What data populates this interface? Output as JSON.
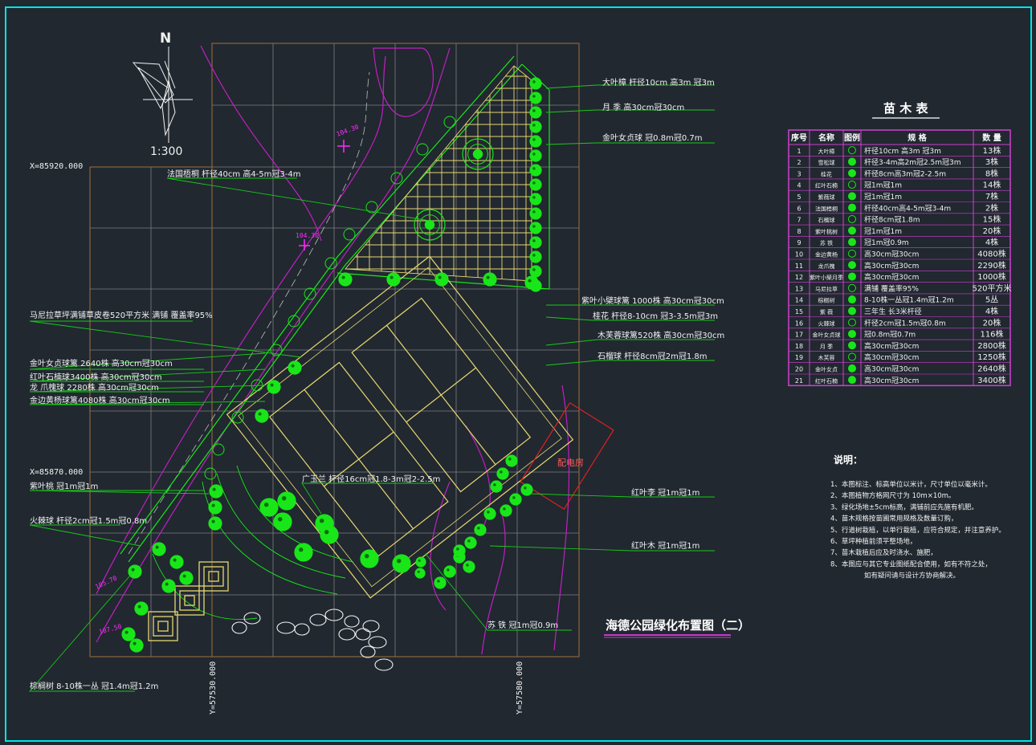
{
  "colors": {
    "background": "#212830",
    "frame": "#00e5e5",
    "grid": "#7f7f7f",
    "plan_outline": "#a0703a",
    "paving": "#e8d870",
    "tree": "#19e619",
    "road": "#c020c0",
    "leader": "#19c919",
    "text": "#f2f2f2",
    "elevation": "#ff2bff",
    "substation": "#e02020",
    "title": "#ffffff",
    "table_border": "#d040d0"
  },
  "north": {
    "letter": "N",
    "scale": "1:300"
  },
  "coordinates": {
    "x_top": "X=85920.000",
    "x_mid": "X=85870.000",
    "y_left": "Y=57530.000",
    "y_right": "Y=57580.000"
  },
  "elevations": [
    "104.30",
    "104.30",
    "105.70",
    "107.50"
  ],
  "substation_label": "配电房",
  "plan_title": "海德公园绿化布置图（二）",
  "left_callouts": [
    "法国梧桐  杆径40cm  高4-5m冠3-4m",
    "马尼拉草坪满铺草皮卷520平方米      满铺      覆盖率95%",
    "金叶女贞球篱  2640株  高30cm冠30cm",
    "红叶石楠球3400株  高30cm冠30cm",
    "龙      爪槐球  2280株  高30cm冠30cm",
    "金边黄杨球篱4080株  高30cm冠30cm",
    "紫叶桃  冠1m冠1m",
    "火棘球  杆径2cm冠1.5m冠0.8m",
    "棕榈树  8-10株一丛  冠1.4m冠1.2m"
  ],
  "right_callouts": [
    "大叶樟  杆径10cm  高3m  冠3m",
    "月      季  高30cm冠30cm",
    "金叶女贞球  冠0.8m冠0.7m",
    "紫叶小檗球篱  1000株  高30cm冠30cm",
    "桂花  杆径8-10cm  冠3-3.5m冠3m",
    "木芙蓉球篱520株  高30cm冠30cm",
    "石榴球  杆径8cm冠2m冠1.8m",
    "红叶李  冠1m冠1m",
    "红叶木  冠1m冠1m",
    "苏      铁  冠1m冠0.9m"
  ],
  "mid_callout": "广玉兰  杆径16cm冠1.8-3m冠2-2.5m",
  "nursery_table": {
    "title": "苗 木 表",
    "headers": [
      "序号",
      "名称",
      "图例",
      "规      格",
      "数 量"
    ],
    "rows": [
      [
        "1",
        "大叶樟",
        "杆径10cm  高3m  冠3m",
        "13株"
      ],
      [
        "2",
        "雪松球",
        "杆径3-4m高2m冠2.5m冠3m",
        "3株"
      ],
      [
        "3",
        "桂花",
        "杆径8cm高3m冠2-2.5m",
        "8株"
      ],
      [
        "4",
        "红叶石楠",
        "冠1m冠1m",
        "14株"
      ],
      [
        "5",
        "紫薇球",
        "冠1m冠1m",
        "7株"
      ],
      [
        "6",
        "法国梧桐",
        "杆径40cm高4-5m冠3-4m",
        "2株"
      ],
      [
        "7",
        "石榴球",
        "杆径8cm冠1.8m",
        "15株"
      ],
      [
        "8",
        "紫叶桃树",
        "冠1m冠1m",
        "20株"
      ],
      [
        "9",
        "苏      铁",
        "冠1m冠0.9m",
        "4株"
      ],
      [
        "10",
        "金边黄杨",
        "高30cm冠30cm",
        "4080株"
      ],
      [
        "11",
        "龙爪槐",
        "高30cm冠30cm",
        "2290株"
      ],
      [
        "12",
        "紫叶小檗月季",
        "高30cm冠30cm",
        "1000株"
      ],
      [
        "13",
        "马尼拉草",
        "满铺      覆盖率95%",
        "520平方米"
      ],
      [
        "14",
        "棕榈树",
        "8-10株一丛冠1.4m冠1.2m",
        "5丛"
      ],
      [
        "15",
        "紫      薇",
        "三年生  长3米杆径",
        "4株"
      ],
      [
        "16",
        "火棘球",
        "杆径2cm冠1.5m冠0.8m",
        "20株"
      ],
      [
        "17",
        "金叶女贞球",
        "冠0.8m冠0.7m",
        "116株"
      ],
      [
        "18",
        "月      季",
        "高30cm冠30cm",
        "2800株"
      ],
      [
        "19",
        "木芙蓉",
        "高30cm冠30cm",
        "1250株"
      ],
      [
        "20",
        "金叶女贞",
        "高30cm冠30cm",
        "2640株"
      ],
      [
        "21",
        "红叶石楠",
        "高30cm冠30cm",
        "3400株"
      ]
    ]
  },
  "notes": {
    "title": "说明：",
    "items": [
      "1、本图标注、标高单位以米计，尺寸单位以毫米计。",
      "2、本图植物方格网尺寸为              10m×10m。",
      "3、绿化场地±5cm标高，满铺前应先施有机肥。",
      "4、苗木规格按苗圃常用规格及数量订购，",
      "5、行道树栽植，以单行栽植，应符合规定，并注意养护。",
      "6、草坪种植前须平整场地，",
      "7、苗木栽植后应及时浇水、施肥，",
      "8、本图应与其它专业图纸配合使用，如有不符之处，",
      "如有疑问请与设计方协商解决。"
    ]
  }
}
